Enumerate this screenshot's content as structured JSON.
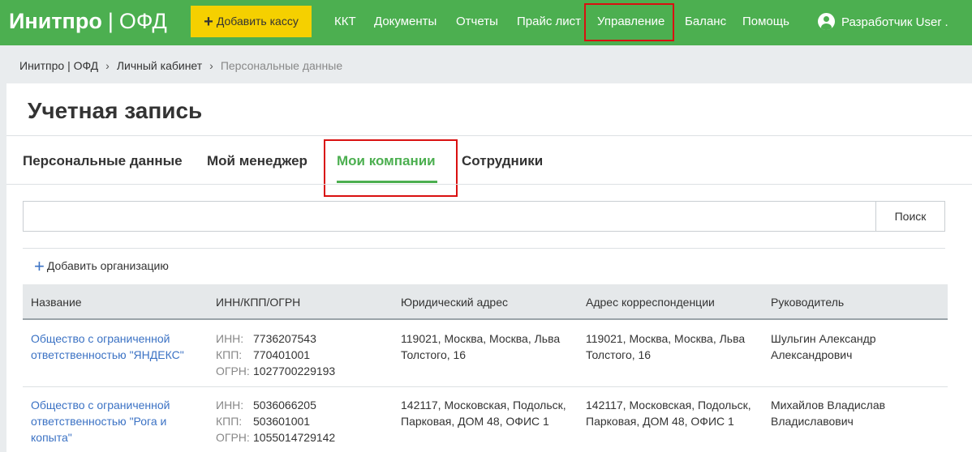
{
  "topbar": {
    "brand_main": "Инитпро",
    "brand_sep": "|",
    "brand_sub": "ОФД",
    "add_kassa_label": "Добавить кассу",
    "nav": [
      "ККТ",
      "Документы",
      "Отчеты",
      "Прайс лист",
      "Управление",
      "Баланс",
      "Помощь"
    ],
    "user_label": "Разработчик User ."
  },
  "breadcrumb": {
    "items": [
      "Инитпро | ОФД",
      "Личный кабинет",
      "Персональные данные"
    ],
    "separator": "›"
  },
  "page": {
    "title": "Учетная запись",
    "tabs": [
      "Персональные данные",
      "Мой менеджер",
      "Мои компании",
      "Сотрудники"
    ],
    "active_tab": "Мои компании"
  },
  "search": {
    "value": "",
    "placeholder": "",
    "button_label": "Поиск"
  },
  "add_org_label": "Добавить организацию",
  "table": {
    "headers": [
      "Название",
      "ИНН/КПП/ОГРН",
      "Юридический адрес",
      "Адрес корреспонденции",
      "Руководитель"
    ],
    "labels": {
      "inn": "ИНН:",
      "kpp": "КПП:",
      "ogrn": "ОГРН:"
    },
    "rows": [
      {
        "name": "Общество с ограниченной ответственностью \"ЯНДЕКС\"",
        "inn": "7736207543",
        "kpp": "770401001",
        "ogrn": "1027700229193",
        "legal_address": "119021, Москва, Москва, Льва Толстого, 16",
        "mail_address": "119021, Москва, Москва, Льва Толстого, 16",
        "director": "Шульгин Александр Александрович"
      },
      {
        "name": "Общество с ограниченной ответственностью \"Рога и копыта\"",
        "inn": "5036066205",
        "kpp": "503601001",
        "ogrn": "1055014729142",
        "legal_address": "142117, Московская, Подольск, Парковая, ДОМ 48, ОФИС 1",
        "mail_address": "142117, Московская, Подольск, Парковая, ДОМ 48, ОФИС 1",
        "director": "Михайлов Владислав Владиславович"
      }
    ]
  },
  "colors": {
    "brand_green": "#4caf50",
    "accent_yellow": "#f5d000",
    "link_blue": "#3b72c4",
    "highlight_red": "#d91010"
  }
}
